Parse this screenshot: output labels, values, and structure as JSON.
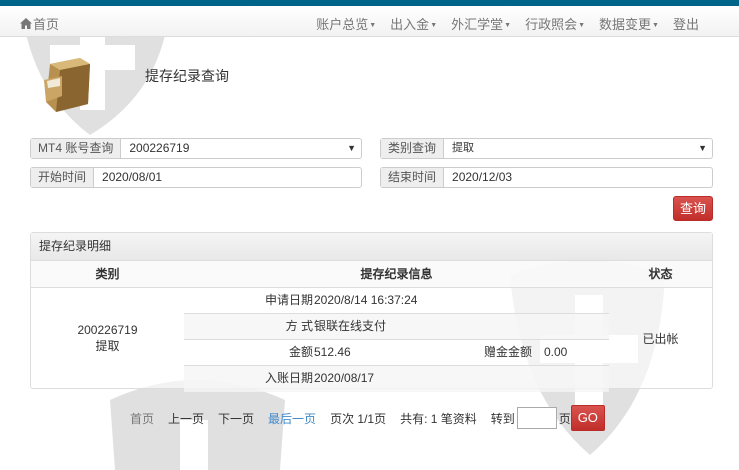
{
  "nav": {
    "home": "首页",
    "menu": [
      "账户总览",
      "出入金",
      "外汇学堂",
      "行政照会",
      "数据变更"
    ],
    "logout": "登出"
  },
  "page": {
    "title": "提存纪录查询"
  },
  "form": {
    "account_label": "MT4 账号查询",
    "account_value": "200226719",
    "type_label": "类别查询",
    "type_value": "提取",
    "start_label": "开始时间",
    "start_value": "2020/08/01",
    "end_label": "结束时间",
    "end_value": "2020/12/03",
    "query_button": "查询"
  },
  "panel": {
    "title": "提存纪录明细",
    "headers": [
      "类别",
      "提存纪录信息",
      "状态"
    ],
    "record": {
      "account": "200226719",
      "type": "提取",
      "status": "已出帐",
      "apply_label": "申请日期",
      "apply_value": "2020/8/14 16:37:24",
      "method_label": "方 式",
      "method_value": "银联在线支付",
      "amount_label": "金额",
      "amount_value": "512.46",
      "bonus_label": "赠金金额",
      "bonus_value": "0.00",
      "credit_label": "入账日期",
      "credit_value": "2020/08/17"
    }
  },
  "pager": {
    "first": "首页",
    "prev": "上一页",
    "next": "下一页",
    "last": "最后一页",
    "page_info": "页次 1/1页",
    "total": "共有: 1 笔资料",
    "goto": "转到",
    "page_suffix": "页",
    "go": "GO"
  },
  "colors": {
    "topbar": "#006489",
    "accent": "#d9534f"
  }
}
